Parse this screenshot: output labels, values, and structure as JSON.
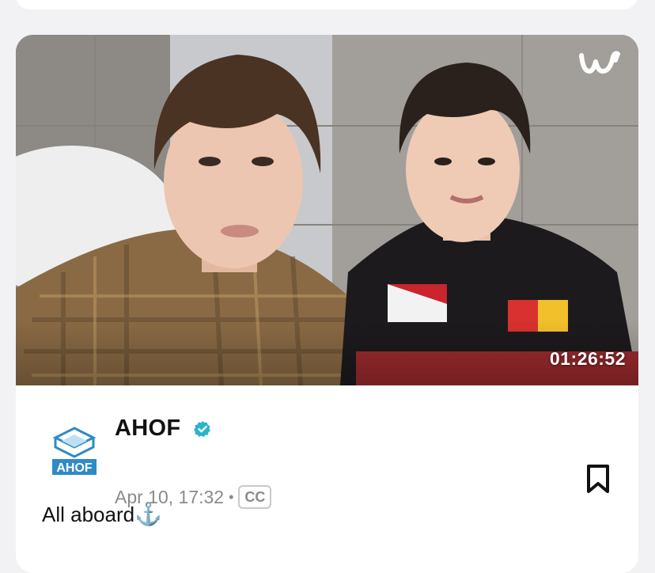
{
  "post": {
    "duration": "01:26:52",
    "channel_name": "AHOF",
    "date": "Apr 10, 17:32",
    "separator": "•",
    "cc_label": "CC",
    "caption_text": "All aboard",
    "caption_emoji": "⚓️",
    "avatar_logo_text": "AHOF",
    "platform_logo": "w"
  },
  "icons": {
    "verified": "verified-badge-icon",
    "bookmark": "bookmark-icon",
    "platform": "weverse-logo-icon"
  },
  "colors": {
    "verified_badge": "#2bb5c9",
    "avatar_logo": "#2f8ac6",
    "text_primary": "#111111",
    "text_secondary": "#8a8a8e"
  }
}
